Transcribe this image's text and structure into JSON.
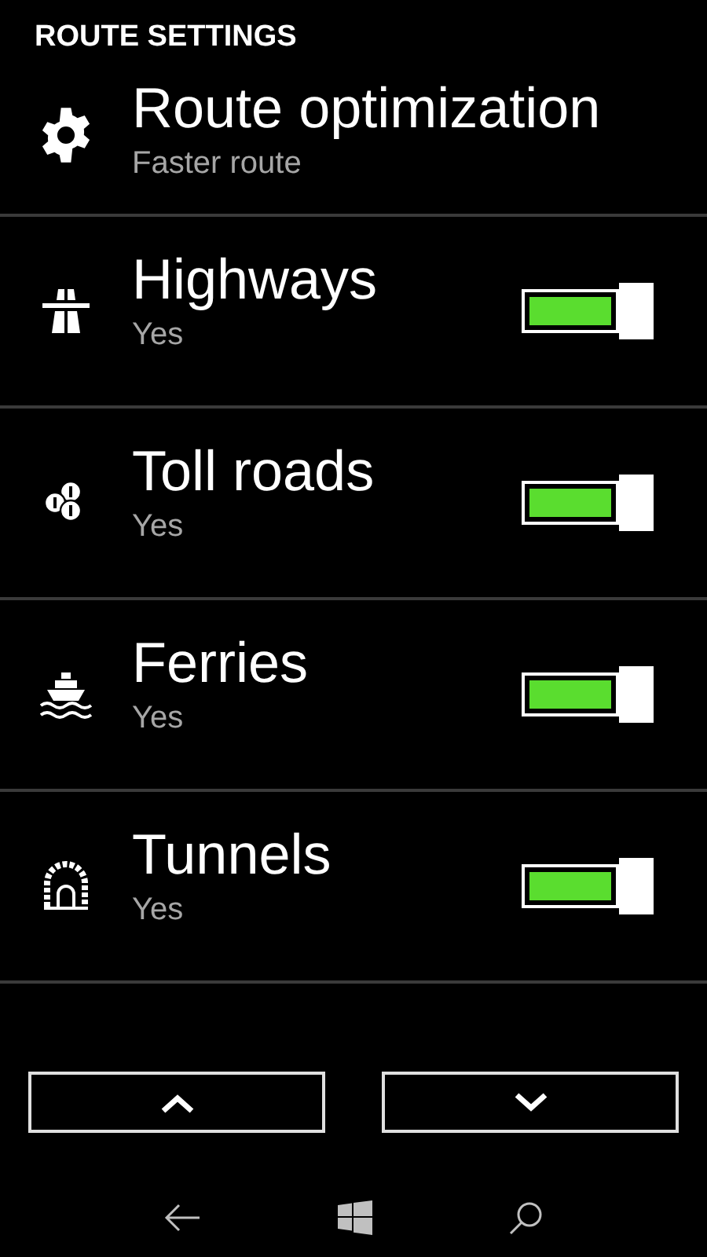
{
  "header": "ROUTE SETTINGS",
  "settings": [
    {
      "kind": "choice",
      "title": "Route optimization",
      "value": "Faster route"
    },
    {
      "kind": "toggle",
      "title": "Highways",
      "value": "Yes",
      "on": true
    },
    {
      "kind": "toggle",
      "title": "Toll roads",
      "value": "Yes",
      "on": true
    },
    {
      "kind": "toggle",
      "title": "Ferries",
      "value": "Yes",
      "on": true
    },
    {
      "kind": "toggle",
      "title": "Tunnels",
      "value": "Yes",
      "on": true
    }
  ]
}
